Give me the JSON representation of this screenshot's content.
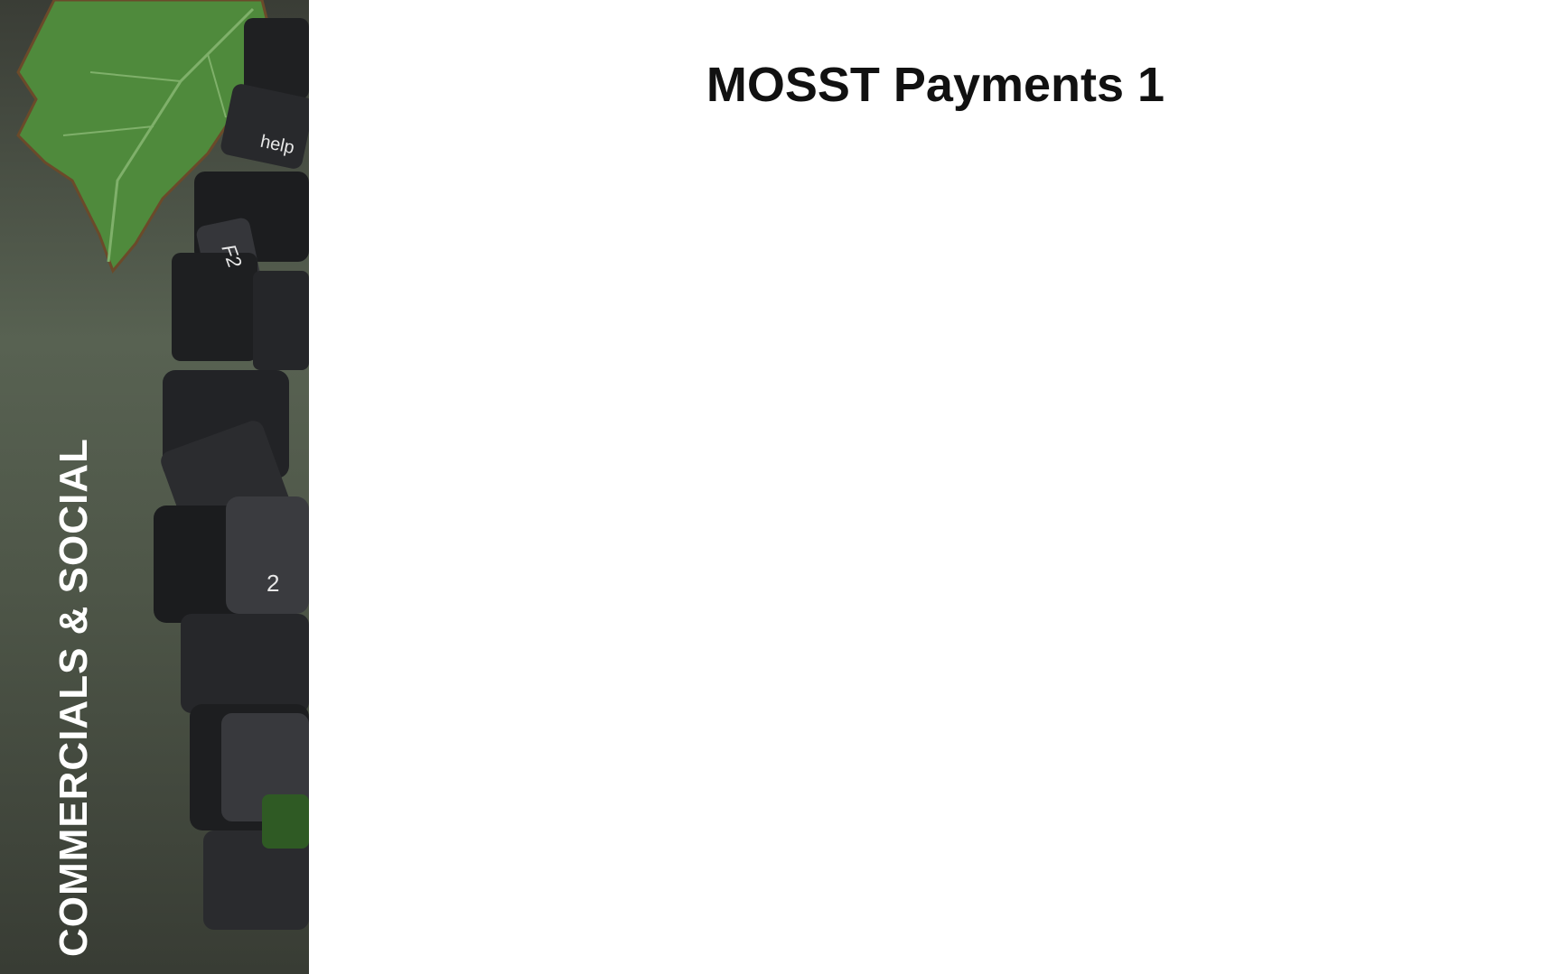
{
  "side_panel": {
    "label": "COMMERCIALS & SOCIAL",
    "key_labels": [
      "help",
      "F2",
      "2"
    ],
    "background_color": "#4e5648"
  },
  "main": {
    "title": "MOSST Payments 1"
  }
}
